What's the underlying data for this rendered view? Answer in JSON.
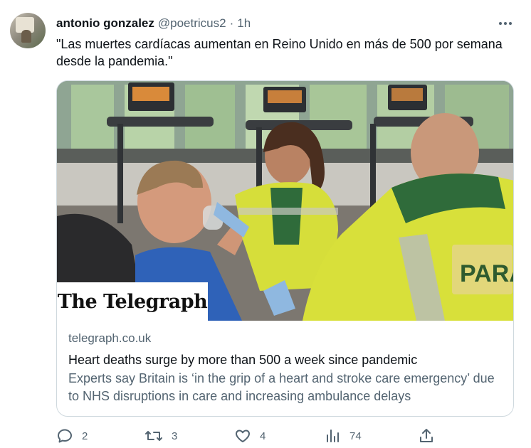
{
  "tweet": {
    "author_name": "antonio gonzalez",
    "author_handle": "@poetricus2",
    "separator": "·",
    "time": "1h",
    "text": "\"Las muertes cardíacas aumentan en Reino Unido en más de 500 por semana desde la pandemia.\"",
    "avatar_icon": "user-photo-avatar",
    "more_icon": "more-horizontal-icon"
  },
  "card": {
    "logo_text": "The Telegraph",
    "domain": "telegraph.co.uk",
    "title": "Heart deaths surge by more than 500 a week since pandemic",
    "description": "Experts say Britain is ‘in the grip of a heart and stroke care emergency’ due to NHS disruptions in care and increasing ambulance delays",
    "image_vest_text": "PARA"
  },
  "actions": {
    "reply_count": "2",
    "retweet_count": "3",
    "like_count": "4",
    "views_count": "74",
    "reply_icon": "reply-icon",
    "retweet_icon": "retweet-icon",
    "like_icon": "heart-icon",
    "views_icon": "views-chart-icon",
    "share_icon": "share-icon"
  },
  "colors": {
    "text_primary": "#0f1419",
    "text_secondary": "#536471",
    "border": "#cfd9de",
    "hi_vis_yellow": "#d8e03a",
    "paramedic_green": "#2f6b3a"
  }
}
